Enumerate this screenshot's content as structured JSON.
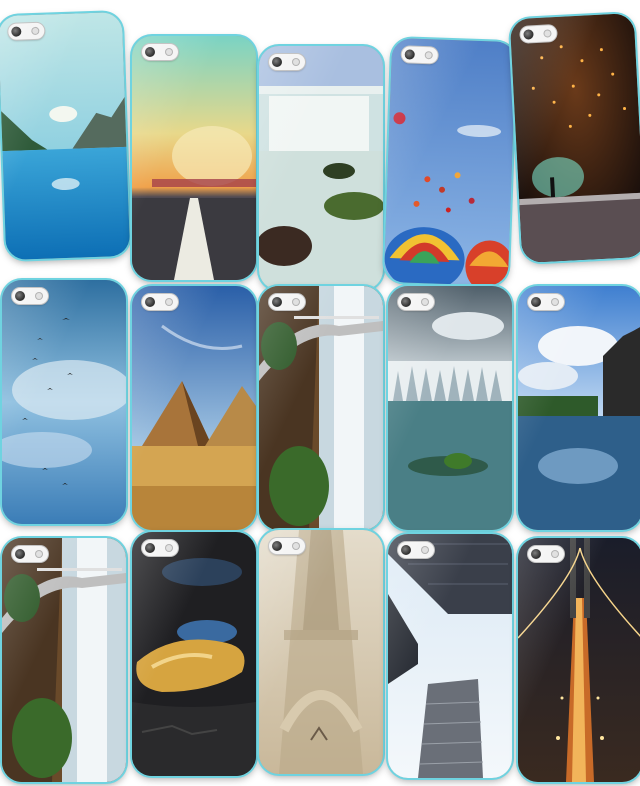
{
  "cases": [
    {
      "name": "case-lake-mountains",
      "motif": "lake-mountains"
    },
    {
      "name": "case-road-sunset",
      "motif": "road-sunset"
    },
    {
      "name": "case-waterfall-river",
      "motif": "waterfall-river"
    },
    {
      "name": "case-hot-air-balloons",
      "motif": "hot-air-balloons"
    },
    {
      "name": "case-fireworks-night",
      "motif": "fireworks-night"
    },
    {
      "name": "case-sky-birds",
      "motif": "sky-birds"
    },
    {
      "name": "case-pyramids",
      "motif": "pyramids"
    },
    {
      "name": "case-bridge-waterfall",
      "motif": "bridge-waterfall"
    },
    {
      "name": "case-forest-river",
      "motif": "forest-river"
    },
    {
      "name": "case-castle-reflection",
      "motif": "castle-reflection"
    },
    {
      "name": "case-bridge-waterfall-2",
      "motif": "bridge-waterfall"
    },
    {
      "name": "case-puddle-reflection",
      "motif": "puddle-reflection"
    },
    {
      "name": "case-eiffel-tower",
      "motif": "eiffel-tower"
    },
    {
      "name": "case-skyscrapers",
      "motif": "skyscrapers"
    },
    {
      "name": "case-bridge-lights",
      "motif": "bridge-lights"
    }
  ]
}
